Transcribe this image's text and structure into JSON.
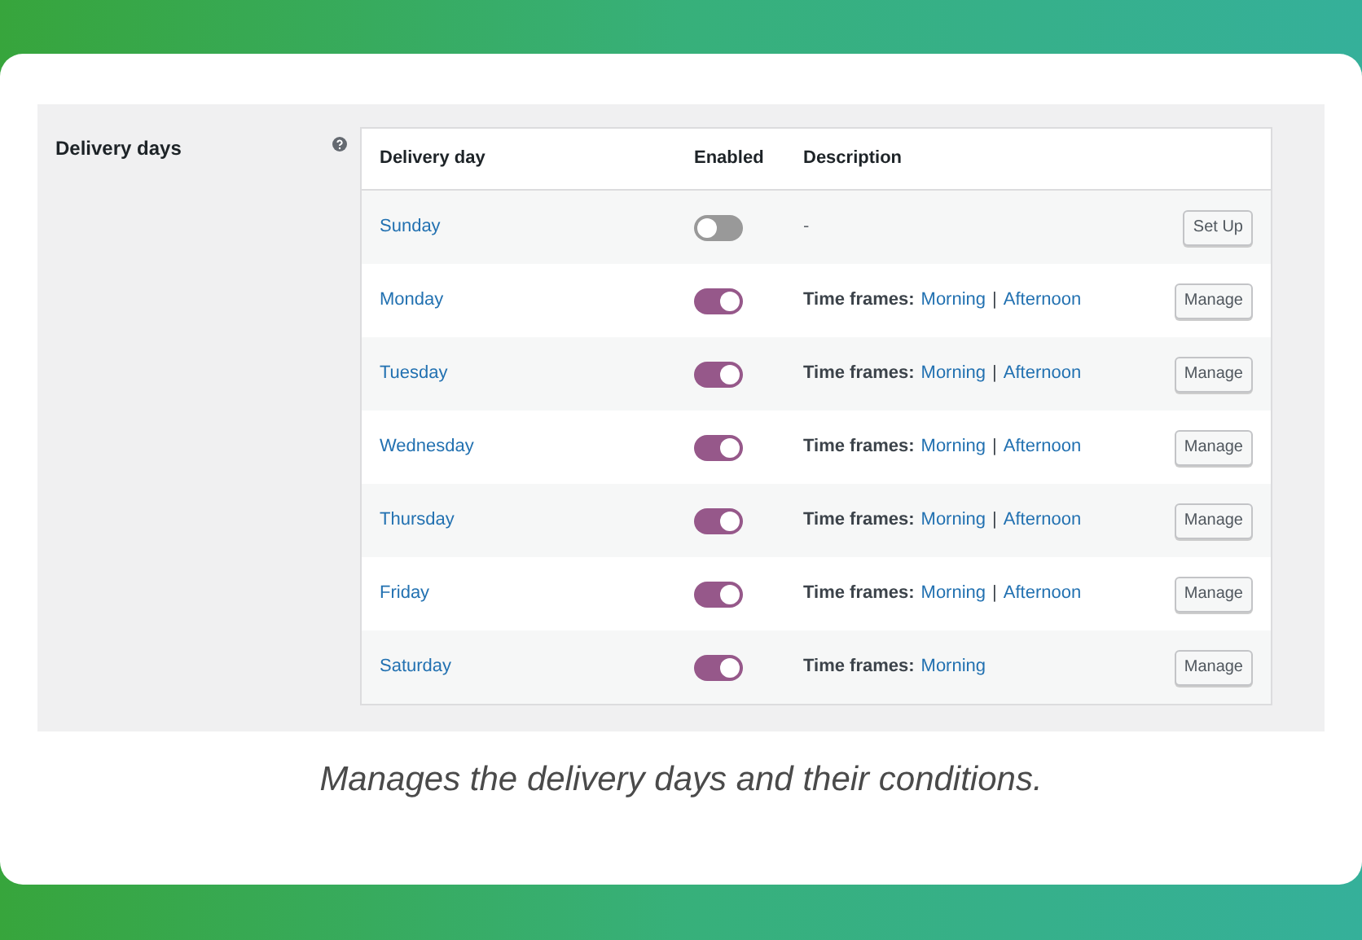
{
  "setting": {
    "label": "Delivery days"
  },
  "table": {
    "columns": [
      "Delivery day",
      "Enabled",
      "Description"
    ],
    "frame_separator": "|",
    "rows": [
      {
        "day": "Sunday",
        "enabled": false,
        "description": {
          "kind": "text",
          "text": "-"
        },
        "button": "Set Up"
      },
      {
        "day": "Monday",
        "enabled": true,
        "description": {
          "kind": "frames",
          "label": "Time frames:",
          "frames": [
            "Morning",
            "Afternoon"
          ]
        },
        "button": "Manage"
      },
      {
        "day": "Tuesday",
        "enabled": true,
        "description": {
          "kind": "frames",
          "label": "Time frames:",
          "frames": [
            "Morning",
            "Afternoon"
          ]
        },
        "button": "Manage"
      },
      {
        "day": "Wednesday",
        "enabled": true,
        "description": {
          "kind": "frames",
          "label": "Time frames:",
          "frames": [
            "Morning",
            "Afternoon"
          ]
        },
        "button": "Manage"
      },
      {
        "day": "Thursday",
        "enabled": true,
        "description": {
          "kind": "frames",
          "label": "Time frames:",
          "frames": [
            "Morning",
            "Afternoon"
          ]
        },
        "button": "Manage"
      },
      {
        "day": "Friday",
        "enabled": true,
        "description": {
          "kind": "frames",
          "label": "Time frames:",
          "frames": [
            "Morning",
            "Afternoon"
          ]
        },
        "button": "Manage"
      },
      {
        "day": "Saturday",
        "enabled": true,
        "description": {
          "kind": "frames",
          "label": "Time frames:",
          "frames": [
            "Morning"
          ]
        },
        "button": "Manage"
      }
    ]
  },
  "caption": "Manages the delivery days and their conditions."
}
